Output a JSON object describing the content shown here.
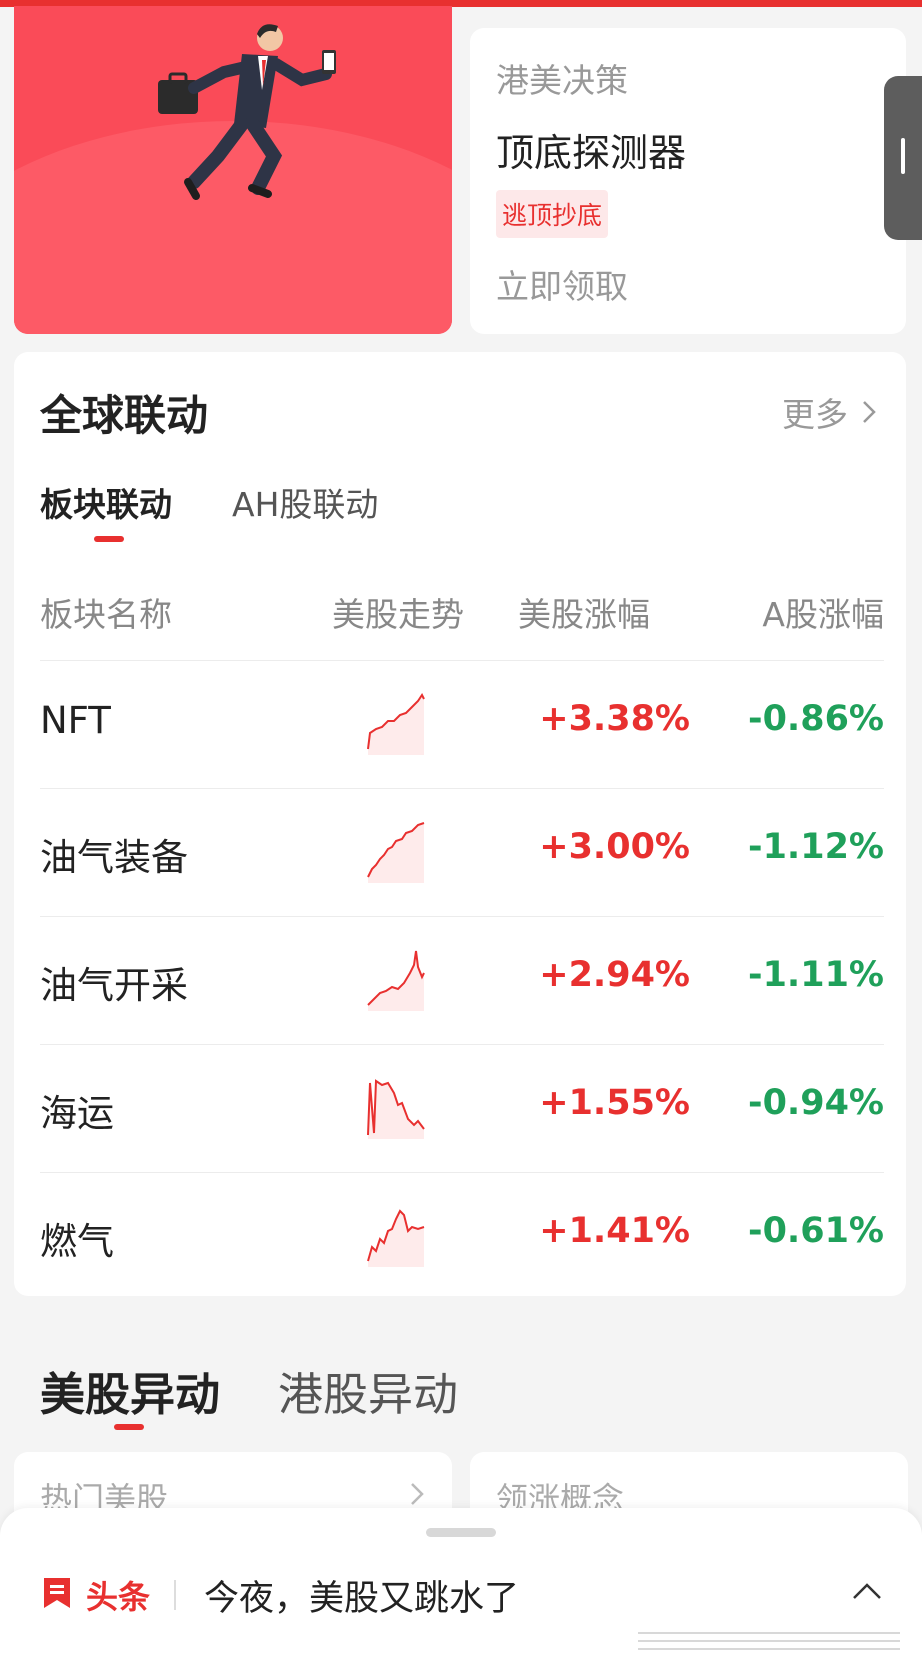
{
  "promo": {
    "subtitle": "港美决策",
    "title": "顶底探测器",
    "tag": "逃顶抄底",
    "cta": "立即领取"
  },
  "global": {
    "title": "全球联动",
    "more_label": "更多",
    "tabs": [
      {
        "label": "板块联动",
        "active": true
      },
      {
        "label": "AH股联动",
        "active": false
      }
    ],
    "columns": [
      "板块名称",
      "美股走势",
      "美股涨幅",
      "A股涨幅"
    ],
    "rows": [
      {
        "name": "NFT",
        "us_change": "+3.38%",
        "a_change": "-0.86%"
      },
      {
        "name": "油气装备",
        "us_change": "+3.00%",
        "a_change": "-1.12%"
      },
      {
        "name": "油气开采",
        "us_change": "+2.94%",
        "a_change": "-1.11%"
      },
      {
        "name": "海运",
        "us_change": "+1.55%",
        "a_change": "-0.94%"
      },
      {
        "name": "燃气",
        "us_change": "+1.41%",
        "a_change": "-0.61%"
      }
    ]
  },
  "movers": {
    "tabs": [
      {
        "label": "美股异动",
        "active": true
      },
      {
        "label": "港股异动",
        "active": false
      }
    ],
    "cards": [
      {
        "label": "热门美股"
      },
      {
        "label": "领涨概念"
      }
    ]
  },
  "news_bar": {
    "label": "头条",
    "headline": "今夜，美股又跳水了"
  },
  "colors": {
    "accent": "#e8302f",
    "up": "#e8302f",
    "down": "#1fa05a",
    "promo_bg": "#fa4b58"
  }
}
